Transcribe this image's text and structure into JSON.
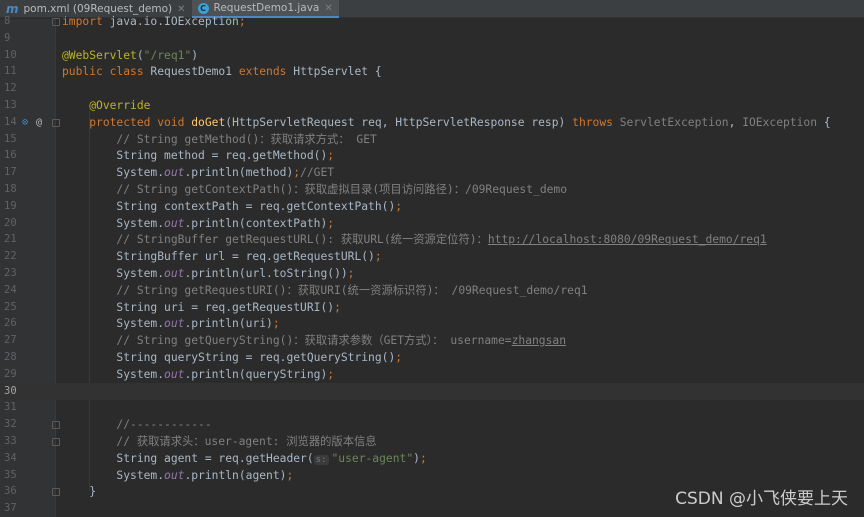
{
  "tabs": [
    {
      "label": "pom.xml (09Request_demo)",
      "icon": "maven-icon",
      "active": false
    },
    {
      "label": "RequestDemo1.java",
      "icon": "java-class-icon",
      "active": true
    }
  ],
  "current_line": 30,
  "lines": [
    {
      "n": 8,
      "t": [
        [
          "kw",
          "import "
        ],
        [
          "",
          "java.io.IOException"
        ],
        [
          "semi",
          ";"
        ]
      ]
    },
    {
      "n": 9,
      "t": []
    },
    {
      "n": 10,
      "t": [
        [
          "ann",
          "@WebServlet"
        ],
        [
          "",
          "("
        ],
        [
          "str",
          "\"/req1\""
        ],
        [
          "",
          ")"
        ]
      ]
    },
    {
      "n": 11,
      "t": [
        [
          "kw",
          "public class "
        ],
        [
          "",
          "RequestDemo1 "
        ],
        [
          "kw",
          "extends "
        ],
        [
          "",
          "HttpServlet {"
        ]
      ]
    },
    {
      "n": 12,
      "t": []
    },
    {
      "n": 13,
      "t": [
        [
          "",
          "    "
        ],
        [
          "ann",
          "@Override"
        ]
      ]
    },
    {
      "n": 14,
      "t": [
        [
          "",
          "    "
        ],
        [
          "kw",
          "protected void "
        ],
        [
          "fn",
          "doGet"
        ],
        [
          "",
          "(HttpServletRequest req, HttpServletResponse resp) "
        ],
        [
          "kw",
          "throws "
        ],
        [
          "cm",
          "ServletException"
        ],
        [
          "",
          ", "
        ],
        [
          "cm",
          "IOException"
        ],
        [
          "",
          " {"
        ]
      ]
    },
    {
      "n": 15,
      "t": [
        [
          "",
          "        "
        ],
        [
          "cm",
          "// String getMethod()：获取请求方式： GET"
        ]
      ]
    },
    {
      "n": 16,
      "t": [
        [
          "",
          "        String method = req.getMethod()"
        ],
        [
          "semi",
          ";"
        ]
      ]
    },
    {
      "n": 17,
      "t": [
        [
          "",
          "        System."
        ],
        [
          "fld",
          "out"
        ],
        [
          "",
          ".println(method)"
        ],
        [
          "semi",
          ";"
        ],
        [
          "cm",
          "//GET"
        ]
      ]
    },
    {
      "n": 18,
      "t": [
        [
          "",
          "        "
        ],
        [
          "cm",
          "// String getContextPath()：获取虚拟目录(项目访问路径)：/09Request_demo"
        ]
      ]
    },
    {
      "n": 19,
      "t": [
        [
          "",
          "        String contextPath = req.getContextPath()"
        ],
        [
          "semi",
          ";"
        ]
      ]
    },
    {
      "n": 20,
      "t": [
        [
          "",
          "        System."
        ],
        [
          "fld",
          "out"
        ],
        [
          "",
          ".println(contextPath)"
        ],
        [
          "semi",
          ";"
        ]
      ]
    },
    {
      "n": 21,
      "t": [
        [
          "",
          "        "
        ],
        [
          "cm",
          "// StringBuffer getRequestURL(): 获取URL(统一资源定位符)："
        ],
        [
          "link",
          "http://localhost:8080/09Request_demo/req1"
        ]
      ]
    },
    {
      "n": 22,
      "t": [
        [
          "",
          "        StringBuffer url = req.getRequestURL()"
        ],
        [
          "semi",
          ";"
        ]
      ]
    },
    {
      "n": 23,
      "t": [
        [
          "",
          "        System."
        ],
        [
          "fld",
          "out"
        ],
        [
          "",
          ".println(url.toString())"
        ],
        [
          "semi",
          ";"
        ]
      ]
    },
    {
      "n": 24,
      "t": [
        [
          "",
          "        "
        ],
        [
          "cm",
          "// String getRequestURI()：获取URI(统一资源标识符)： /09Request_demo/req1"
        ]
      ]
    },
    {
      "n": 25,
      "t": [
        [
          "",
          "        String uri = req.getRequestURI()"
        ],
        [
          "semi",
          ";"
        ]
      ]
    },
    {
      "n": 26,
      "t": [
        [
          "",
          "        System."
        ],
        [
          "fld",
          "out"
        ],
        [
          "",
          ".println(uri)"
        ],
        [
          "semi",
          ";"
        ]
      ]
    },
    {
      "n": 27,
      "t": [
        [
          "",
          "        "
        ],
        [
          "cm",
          "// String getQueryString()：获取请求参数（GET方式）： username="
        ],
        [
          "link",
          "zhangsan"
        ]
      ]
    },
    {
      "n": 28,
      "t": [
        [
          "",
          "        String queryString = req.getQueryString()"
        ],
        [
          "semi",
          ";"
        ]
      ]
    },
    {
      "n": 29,
      "t": [
        [
          "",
          "        System."
        ],
        [
          "fld",
          "out"
        ],
        [
          "",
          ".println(queryString)"
        ],
        [
          "semi",
          ";"
        ]
      ]
    },
    {
      "n": 30,
      "t": []
    },
    {
      "n": 31,
      "t": []
    },
    {
      "n": 32,
      "t": [
        [
          "",
          "        "
        ],
        [
          "cm",
          "//------------"
        ]
      ]
    },
    {
      "n": 33,
      "t": [
        [
          "",
          "        "
        ],
        [
          "cm",
          "// 获取请求头：user-agent: 浏览器的版本信息"
        ]
      ]
    },
    {
      "n": 34,
      "t": [
        [
          "",
          "        String agent = req.getHeader("
        ],
        [
          "hint",
          "s:"
        ],
        [
          "str",
          "\"user-agent\""
        ],
        [
          "",
          ")"
        ],
        [
          "semi",
          ";"
        ]
      ]
    },
    {
      "n": 35,
      "t": [
        [
          "",
          "        System."
        ],
        [
          "fld",
          "out"
        ],
        [
          "",
          ".println(agent)"
        ],
        [
          "semi",
          ";"
        ]
      ]
    },
    {
      "n": 36,
      "t": [
        [
          "",
          "    }"
        ]
      ]
    },
    {
      "n": 37,
      "t": []
    }
  ],
  "fold_lines": [
    8,
    14,
    32,
    33,
    36
  ],
  "gutter_icons": {
    "line": 14,
    "override": "override-method-icon",
    "annotation": "@"
  },
  "watermark": "CSDN @小飞侠要上天"
}
